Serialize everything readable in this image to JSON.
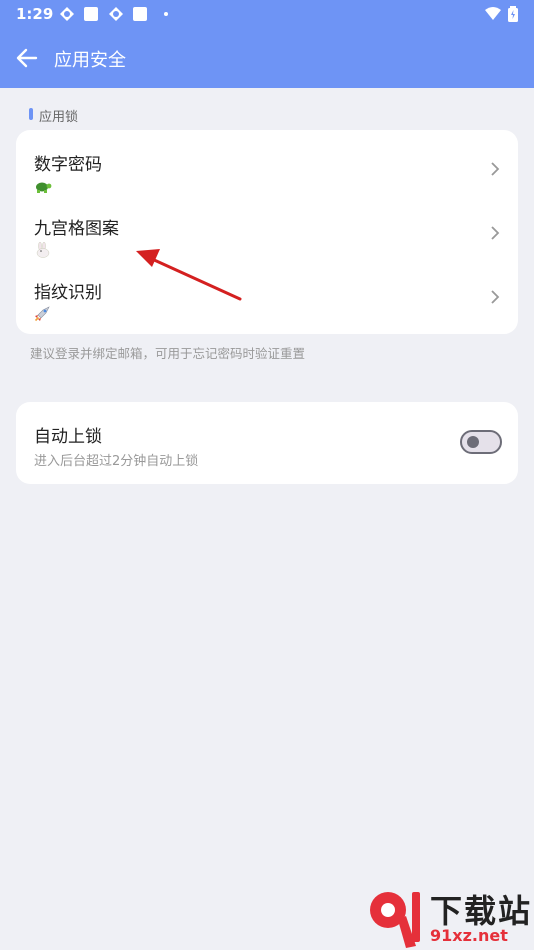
{
  "status_bar": {
    "time": "1:29"
  },
  "app_bar": {
    "title": "应用安全"
  },
  "section": {
    "header": "应用锁"
  },
  "lock_options": [
    {
      "label": "数字密码",
      "icon": "turtle-icon"
    },
    {
      "label": "九宫格图案",
      "icon": "rabbit-icon"
    },
    {
      "label": "指纹识别",
      "icon": "rocket-icon"
    }
  ],
  "hint": "建议登录并绑定邮箱，可用于忘记密码时验证重置",
  "auto_lock": {
    "label": "自动上锁",
    "description": "进入后台超过2分钟自动上锁",
    "enabled": false
  },
  "watermark": {
    "brand": "下载站",
    "site": "91xz.net"
  },
  "colors": {
    "accent": "#6e94f5",
    "background": "#eff0f5",
    "annotation_arrow": "#d42020"
  }
}
